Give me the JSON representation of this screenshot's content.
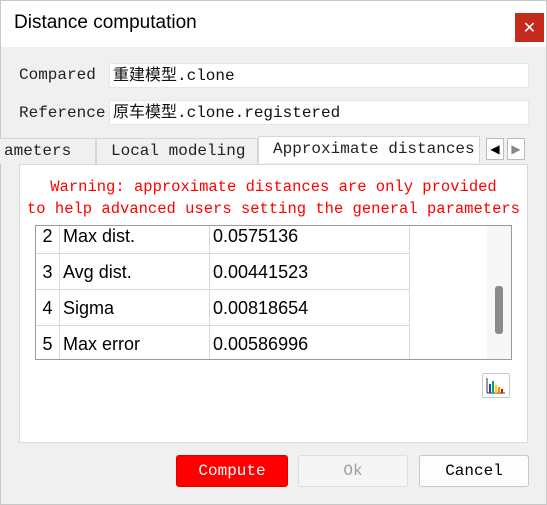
{
  "window": {
    "title": "Distance computation",
    "close_glyph": "✕"
  },
  "fields": {
    "compared": {
      "label": "Compared",
      "value": "重建模型.clone"
    },
    "reference": {
      "label": "Reference",
      "value": "原车模型.clone.registered"
    }
  },
  "tabs": [
    {
      "label": "ameters",
      "active": false
    },
    {
      "label": "Local modeling",
      "active": false
    },
    {
      "label": "Approximate distances",
      "active": true
    }
  ],
  "tab_arrows": {
    "left": "◀",
    "right": "▶"
  },
  "warning": {
    "line1": "Warning: approximate distances are only provided",
    "line2": "to help advanced users setting the general parameters"
  },
  "table": {
    "rows": [
      {
        "index": "2",
        "name": "Max dist.",
        "value": "0.0575136"
      },
      {
        "index": "3",
        "name": "Avg dist.",
        "value": "0.00441523"
      },
      {
        "index": "4",
        "name": "Sigma",
        "value": "0.00818654"
      },
      {
        "index": "5",
        "name": "Max error",
        "value": "0.00586996"
      }
    ],
    "scroll_position": 0.6
  },
  "histogram_icon": "histogram-icon",
  "buttons": {
    "compute": "Compute",
    "ok": "Ok",
    "cancel": "Cancel"
  },
  "colors": {
    "accent": "#ff0000",
    "close": "#c42b1c",
    "warning": "#ff0000"
  }
}
